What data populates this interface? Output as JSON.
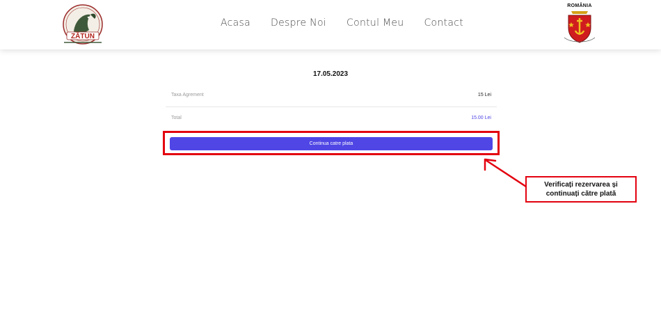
{
  "header": {
    "logo_left": {
      "text": "ZĂTUN",
      "icon": "fish-logo-icon"
    },
    "nav": [
      {
        "label": "Acasa"
      },
      {
        "label": "Despre Noi"
      },
      {
        "label": "Contul Meu"
      },
      {
        "label": "Contact"
      }
    ],
    "logo_right": {
      "title": "ROMÂNIA",
      "icon": "county-crest-icon"
    }
  },
  "booking": {
    "date": "17.05.2023",
    "fee_label": "Taxa Agrement",
    "fee_value": "15 Lei",
    "total_label": "Total",
    "total_value": "15.00 Lei",
    "pay_button": "Continua catre plata"
  },
  "annotation": {
    "line1": "Verificați rezervarea și",
    "line2": "continuați către plată",
    "color": "#e3000f"
  },
  "colors": {
    "accent": "#4f46e5",
    "annotation_red": "#e3000f"
  }
}
